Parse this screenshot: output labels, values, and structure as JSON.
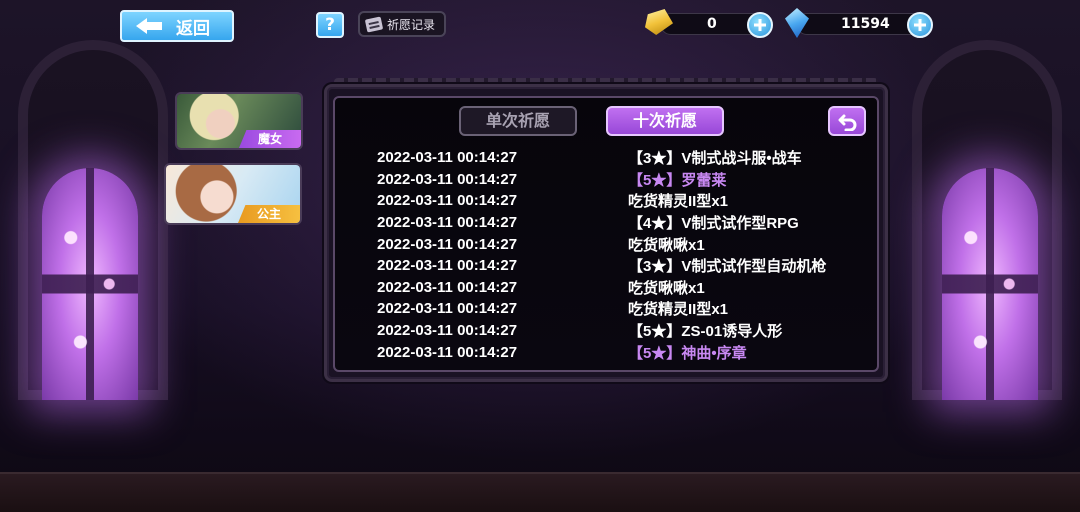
{
  "topbar": {
    "back_label": "返回",
    "help_label": "?",
    "record_label": "祈愿记录",
    "gold_value": "0",
    "gem_value": "11594",
    "gold_icon": "gold-ticket-icon",
    "gem_icon": "blue-crystal-icon"
  },
  "characters": [
    {
      "label": "魔女"
    },
    {
      "label": "公主"
    }
  ],
  "tabs": {
    "single": "单次祈愿",
    "ten": "十次祈愿"
  },
  "colors": {
    "accent_purple": "#a858e0",
    "five_star_text": "#c888f2",
    "button_blue": "#36a6ee"
  },
  "records": [
    {
      "time": "2022-03-11 00:14:27",
      "item": "【3★】V制式战斗服•战车",
      "rarity": 3
    },
    {
      "time": "2022-03-11 00:14:27",
      "item": "【5★】罗蕾莱",
      "rarity": 5
    },
    {
      "time": "2022-03-11 00:14:27",
      "item": "吃货精灵II型x1",
      "rarity": 0
    },
    {
      "time": "2022-03-11 00:14:27",
      "item": "【4★】V制式试作型RPG",
      "rarity": 4
    },
    {
      "time": "2022-03-11 00:14:27",
      "item": "吃货啾啾x1",
      "rarity": 0
    },
    {
      "time": "2022-03-11 00:14:27",
      "item": "【3★】V制式试作型自动机枪",
      "rarity": 3
    },
    {
      "time": "2022-03-11 00:14:27",
      "item": "吃货啾啾x1",
      "rarity": 0
    },
    {
      "time": "2022-03-11 00:14:27",
      "item": "吃货精灵II型x1",
      "rarity": 0
    },
    {
      "time": "2022-03-11 00:14:27",
      "item": "【5★】ZS-01诱导人形",
      "rarity": 5
    },
    {
      "time": "2022-03-11 00:14:27",
      "item": "【5★】神曲•序章",
      "rarity": 5
    }
  ]
}
